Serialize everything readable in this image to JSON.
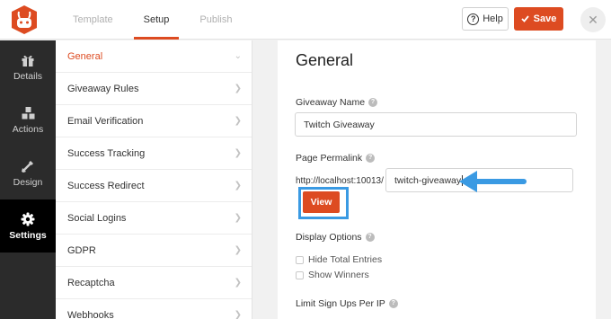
{
  "header": {
    "tabs": [
      {
        "label": "Template",
        "active": false
      },
      {
        "label": "Setup",
        "active": true
      },
      {
        "label": "Publish",
        "active": false
      }
    ],
    "help_label": "Help",
    "save_label": "Save",
    "close_symbol": "✕"
  },
  "rail": {
    "items": [
      {
        "label": "Details",
        "icon": "gift-icon",
        "active": false
      },
      {
        "label": "Actions",
        "icon": "cubes-icon",
        "active": false
      },
      {
        "label": "Design",
        "icon": "brush-icon",
        "active": false
      },
      {
        "label": "Settings",
        "icon": "gear-icon",
        "active": true
      }
    ]
  },
  "subnav": {
    "items": [
      {
        "label": "General",
        "active": true
      },
      {
        "label": "Giveaway Rules",
        "active": false
      },
      {
        "label": "Email Verification",
        "active": false
      },
      {
        "label": "Success Tracking",
        "active": false
      },
      {
        "label": "Success Redirect",
        "active": false
      },
      {
        "label": "Social Logins",
        "active": false
      },
      {
        "label": "GDPR",
        "active": false
      },
      {
        "label": "Recaptcha",
        "active": false
      },
      {
        "label": "Webhooks",
        "active": false
      }
    ]
  },
  "main": {
    "title": "General",
    "giveaway_name_label": "Giveaway Name",
    "giveaway_name_value": "Twitch Giveaway",
    "permalink_label": "Page Permalink",
    "permalink_prefix": "http://localhost:10013/",
    "permalink_value": "twitch-giveaway",
    "view_label": "View",
    "display_options_label": "Display Options",
    "display_options": [
      {
        "label": "Hide Total Entries",
        "checked": false
      },
      {
        "label": "Show Winners",
        "checked": false
      }
    ],
    "limit_label": "Limit Sign Ups Per IP"
  },
  "colors": {
    "accent": "#dd4b21",
    "highlight": "#3a9ae3",
    "rail_bg": "#2b2b2b"
  }
}
